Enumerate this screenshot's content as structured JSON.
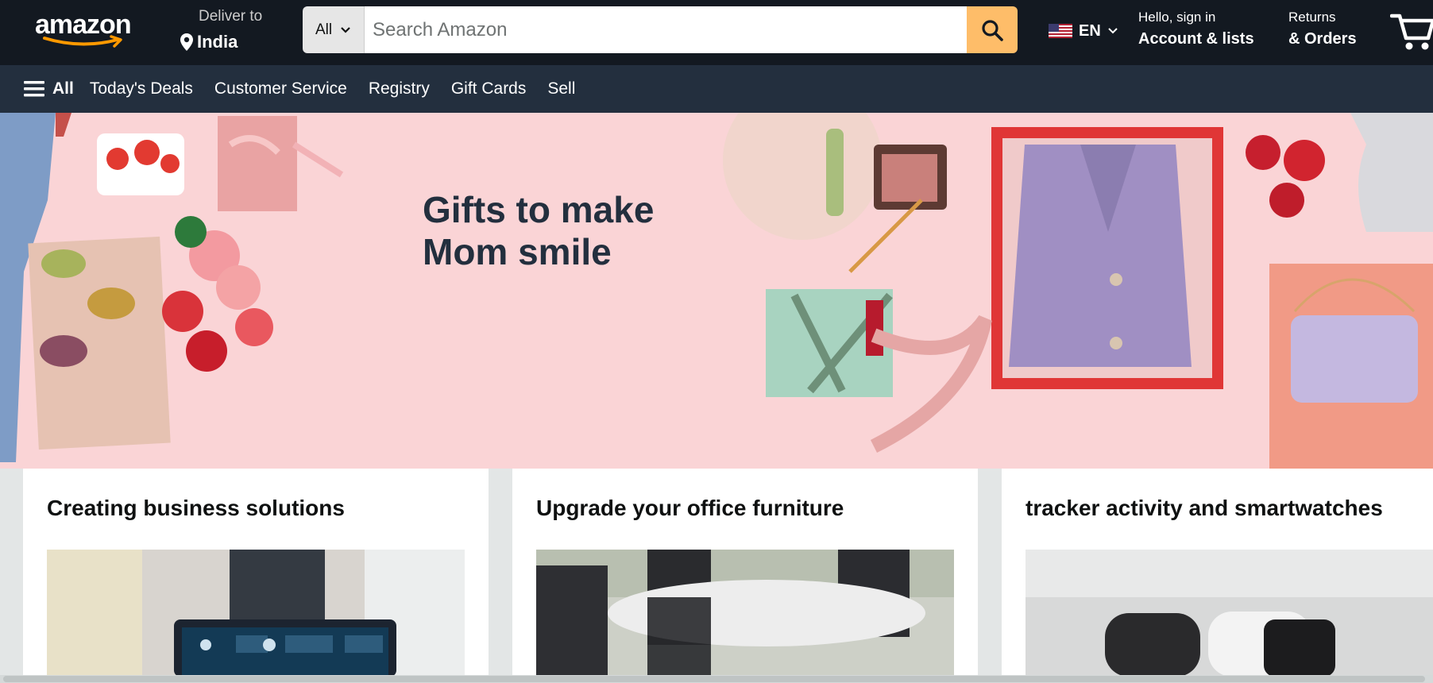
{
  "header": {
    "logo_text": "amazon",
    "deliver_label": "Deliver to",
    "deliver_location": "India",
    "search": {
      "category": "All",
      "placeholder": "Search Amazon"
    },
    "language": "EN",
    "account_greeting": "Hello, sign in",
    "account_label": "Account & lists",
    "returns_label": "Returns",
    "orders_label": "& Orders"
  },
  "nav": {
    "all_label": "All",
    "items": [
      "Today's Deals",
      "Customer Service",
      "Registry",
      "Gift Cards",
      "Sell"
    ]
  },
  "hero": {
    "title_line1": "Gifts to make",
    "title_line2": "Mom smile"
  },
  "cards": [
    {
      "title": "Creating business solutions"
    },
    {
      "title": "Upgrade your office furniture"
    },
    {
      "title": "tracker activity and smartwatches"
    }
  ],
  "colors": {
    "header_bg": "#131921",
    "nav_bg": "#232f3e",
    "search_button": "#febd69",
    "hero_bg": "#fad4d6",
    "page_bg": "#e3e6e6"
  },
  "icons": [
    "pin-icon",
    "chevron-down-icon",
    "search-icon",
    "us-flag-icon",
    "cart-icon",
    "hamburger-icon"
  ]
}
